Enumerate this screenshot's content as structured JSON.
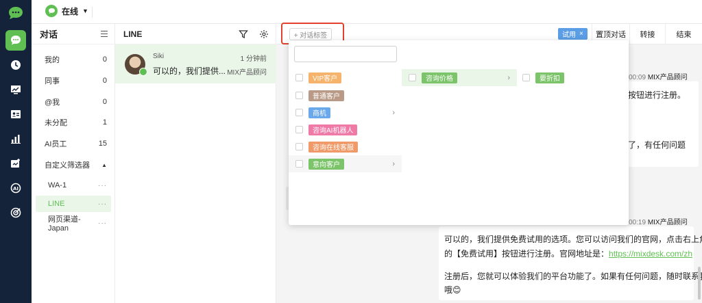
{
  "header": {
    "status_label": "在线"
  },
  "conversations": {
    "title": "对话",
    "items": [
      {
        "label": "我的",
        "count": "0"
      },
      {
        "label": "同事",
        "count": "0"
      },
      {
        "label": "@我",
        "count": "0"
      },
      {
        "label": "未分配",
        "count": "1"
      },
      {
        "label": "AI员工",
        "count": "15"
      }
    ],
    "filter_title": "自定义筛选器",
    "filters": [
      {
        "label": "WA-1",
        "more": "···"
      },
      {
        "label": "LINE",
        "more": "···"
      },
      {
        "label": "网页渠道-Japan",
        "more": "···"
      }
    ]
  },
  "chat_list": {
    "title": "LINE",
    "row": {
      "name": "Siki",
      "time": "1 分钟前",
      "preview": "可以的，我们提供...",
      "agent": "MIX产品顾问"
    }
  },
  "toolbar": {
    "tag_button": "+ 对话标签",
    "trial_chip": "试用",
    "trial_close": "×",
    "pin_label": "置顶对话",
    "transfer_label": "转接",
    "end_label": "结束"
  },
  "messages": {
    "msg1_meta_time": "00:09",
    "msg1_meta_agent": "MIX产品顾问",
    "msg1_line1": "按钮进行注册。",
    "msg1_line2": "了，有任何问题",
    "msg2_meta_time": "00:19",
    "msg2_meta_agent": "MIX产品顾问",
    "msg2_line1": "可以的，我们提供免费试用的选项。您可以访问我们的官网，点击右上角",
    "msg2_line2_pre": "的【免费试用】按钮进行注册。官网地址是：",
    "msg2_link": "https://mixdesk.com/zh",
    "msg2_line3": "注册后，您就可以体验我们的平台功能了。如果有任何问题，随时联系我",
    "msg2_line4": "哦😊"
  },
  "dropdown": {
    "tags": [
      {
        "label": "VIP客户",
        "color": "#f5b36b"
      },
      {
        "label": "普通客户",
        "color": "#b89a86"
      },
      {
        "label": "商机",
        "color": "#6aa8ec"
      },
      {
        "label": "咨询AI机器人",
        "color": "#f07aa6"
      },
      {
        "label": "咨询在线客服",
        "color": "#ef9a68"
      },
      {
        "label": "意向客户",
        "color": "#7cc46a"
      }
    ],
    "sub_tag": {
      "label": "咨询价格",
      "color": "#7cc46a"
    },
    "sub_sub_tag": {
      "label": "要折扣",
      "color": "#7cc46a"
    },
    "arrow": "›"
  }
}
